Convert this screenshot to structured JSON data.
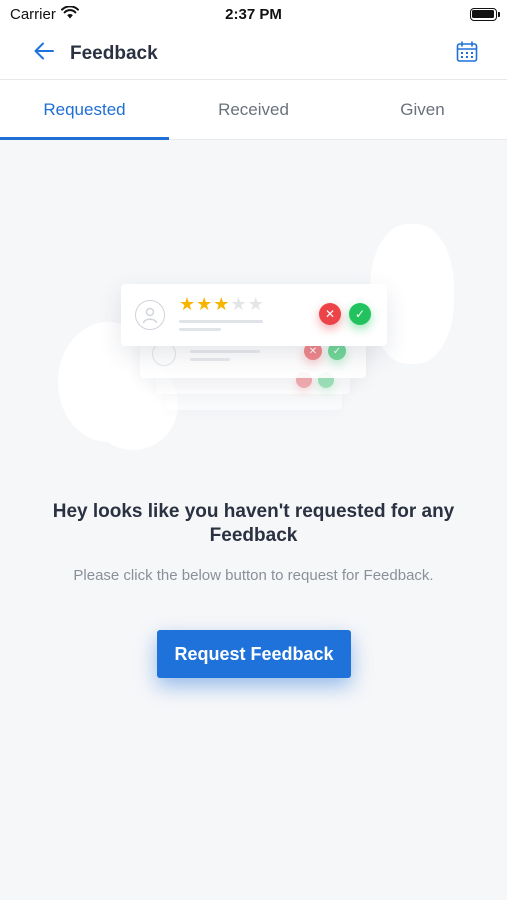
{
  "status_bar": {
    "carrier": "Carrier",
    "time": "2:37 PM"
  },
  "header": {
    "title": "Feedback",
    "back_icon": "arrow-left-icon",
    "calendar_icon": "calendar-icon"
  },
  "tabs": [
    {
      "label": "Requested",
      "active": true
    },
    {
      "label": "Received",
      "active": false
    },
    {
      "label": "Given",
      "active": false
    }
  ],
  "illustration": {
    "rating_filled": 3,
    "rating_total": 5
  },
  "empty_state": {
    "title": "Hey looks like you haven't requested for any Feedback",
    "subtitle": "Please click the below button to request for Feedback.",
    "button_label": "Request Feedback"
  },
  "colors": {
    "accent": "#1f72d9",
    "star": "#f7b500",
    "reject": "#ec4348",
    "accept": "#22c35e"
  }
}
